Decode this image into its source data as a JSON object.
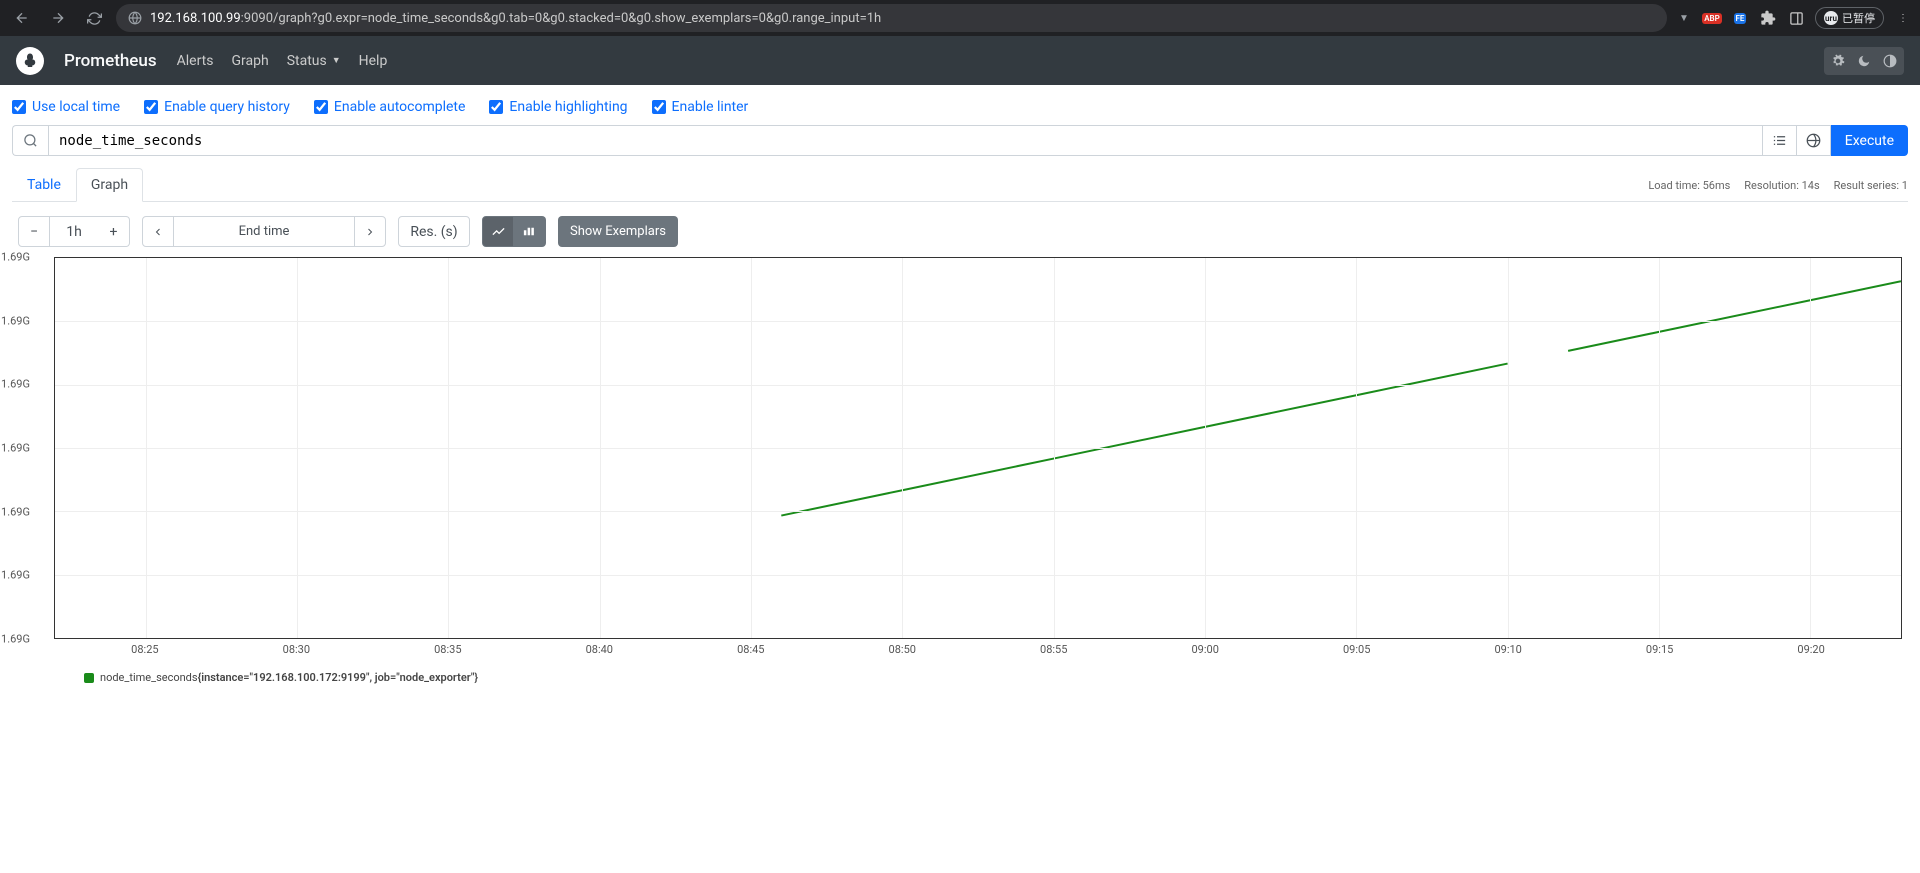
{
  "browser": {
    "url_host": "192.168.100.99",
    "url_port_path": ":9090/graph?g0.expr=node_time_seconds&g0.tab=0&g0.stacked=0&g0.show_exemplars=0&g0.range_input=1h",
    "pause_label": "已暂停",
    "pause_badge": "uru"
  },
  "header": {
    "brand": "Prometheus",
    "links": [
      "Alerts",
      "Graph",
      "Status",
      "Help"
    ]
  },
  "options": [
    "Use local time",
    "Enable query history",
    "Enable autocomplete",
    "Enable highlighting",
    "Enable linter"
  ],
  "query": {
    "expression": "node_time_seconds",
    "execute_label": "Execute"
  },
  "tabs": {
    "table": "Table",
    "graph": "Graph"
  },
  "stats": {
    "load": "Load time: 56ms",
    "resolution": "Resolution: 14s",
    "series": "Result series: 1"
  },
  "controls": {
    "range": "1h",
    "end_time_placeholder": "End time",
    "res_placeholder": "Res. (s)",
    "show_exemplars": "Show Exemplars"
  },
  "chart_data": {
    "type": "line",
    "title": "",
    "xlabel": "",
    "ylabel": "",
    "x_ticks": [
      "08:25",
      "08:30",
      "08:35",
      "08:40",
      "08:45",
      "08:50",
      "08:55",
      "09:00",
      "09:05",
      "09:10",
      "09:15",
      "09:20"
    ],
    "y_ticks": [
      "1.69G",
      "1.69G",
      "1.69G",
      "1.69G",
      "1.69G",
      "1.69G",
      "1.69G"
    ],
    "ylim": [
      1690000000,
      1690003600
    ],
    "series": [
      {
        "name": "node_time_seconds{instance=\"192.168.100.172:9199\", job=\"node_exporter\"}",
        "segments": [
          {
            "x": [
              "08:46",
              "08:50",
              "08:55",
              "09:00",
              "09:05",
              "09:10"
            ],
            "values": [
              1690001160,
              1690001400,
              1690001700,
              1690002000,
              1690002300,
              1690002600
            ]
          },
          {
            "x": [
              "09:12",
              "09:15",
              "09:20",
              "09:23"
            ],
            "values": [
              1690002720,
              1690002900,
              1690003200,
              1690003380
            ]
          }
        ],
        "color": "#1a8b1a"
      }
    ]
  },
  "legend": {
    "metric": "node_time_seconds",
    "labels": "{instance=\"192.168.100.172:9199\", job=\"node_exporter\"}"
  }
}
